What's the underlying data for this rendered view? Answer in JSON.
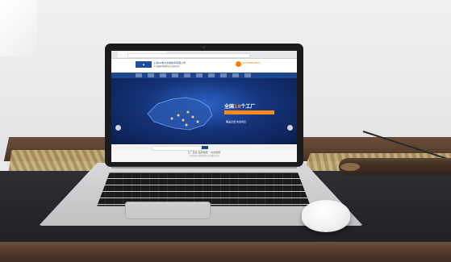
{
  "screen": {
    "company": "上海XX电力系统技术有限公司",
    "subtitle": "专业输配电网解决方案服务商",
    "phone_label": "400-8888-888",
    "headline_prefix": "全国",
    "headline_highlight": "18",
    "headline_suffix": "个工厂",
    "subline": "覆盖全国 快速响应",
    "promo": "工厂直供 品质保障 一站式服务",
    "promo_small": "专业团队为您提供全方位解决方案"
  },
  "colors": {
    "brand": "#1c478f",
    "accent": "#ff8c1a",
    "mouse": "#f2f2f2"
  }
}
